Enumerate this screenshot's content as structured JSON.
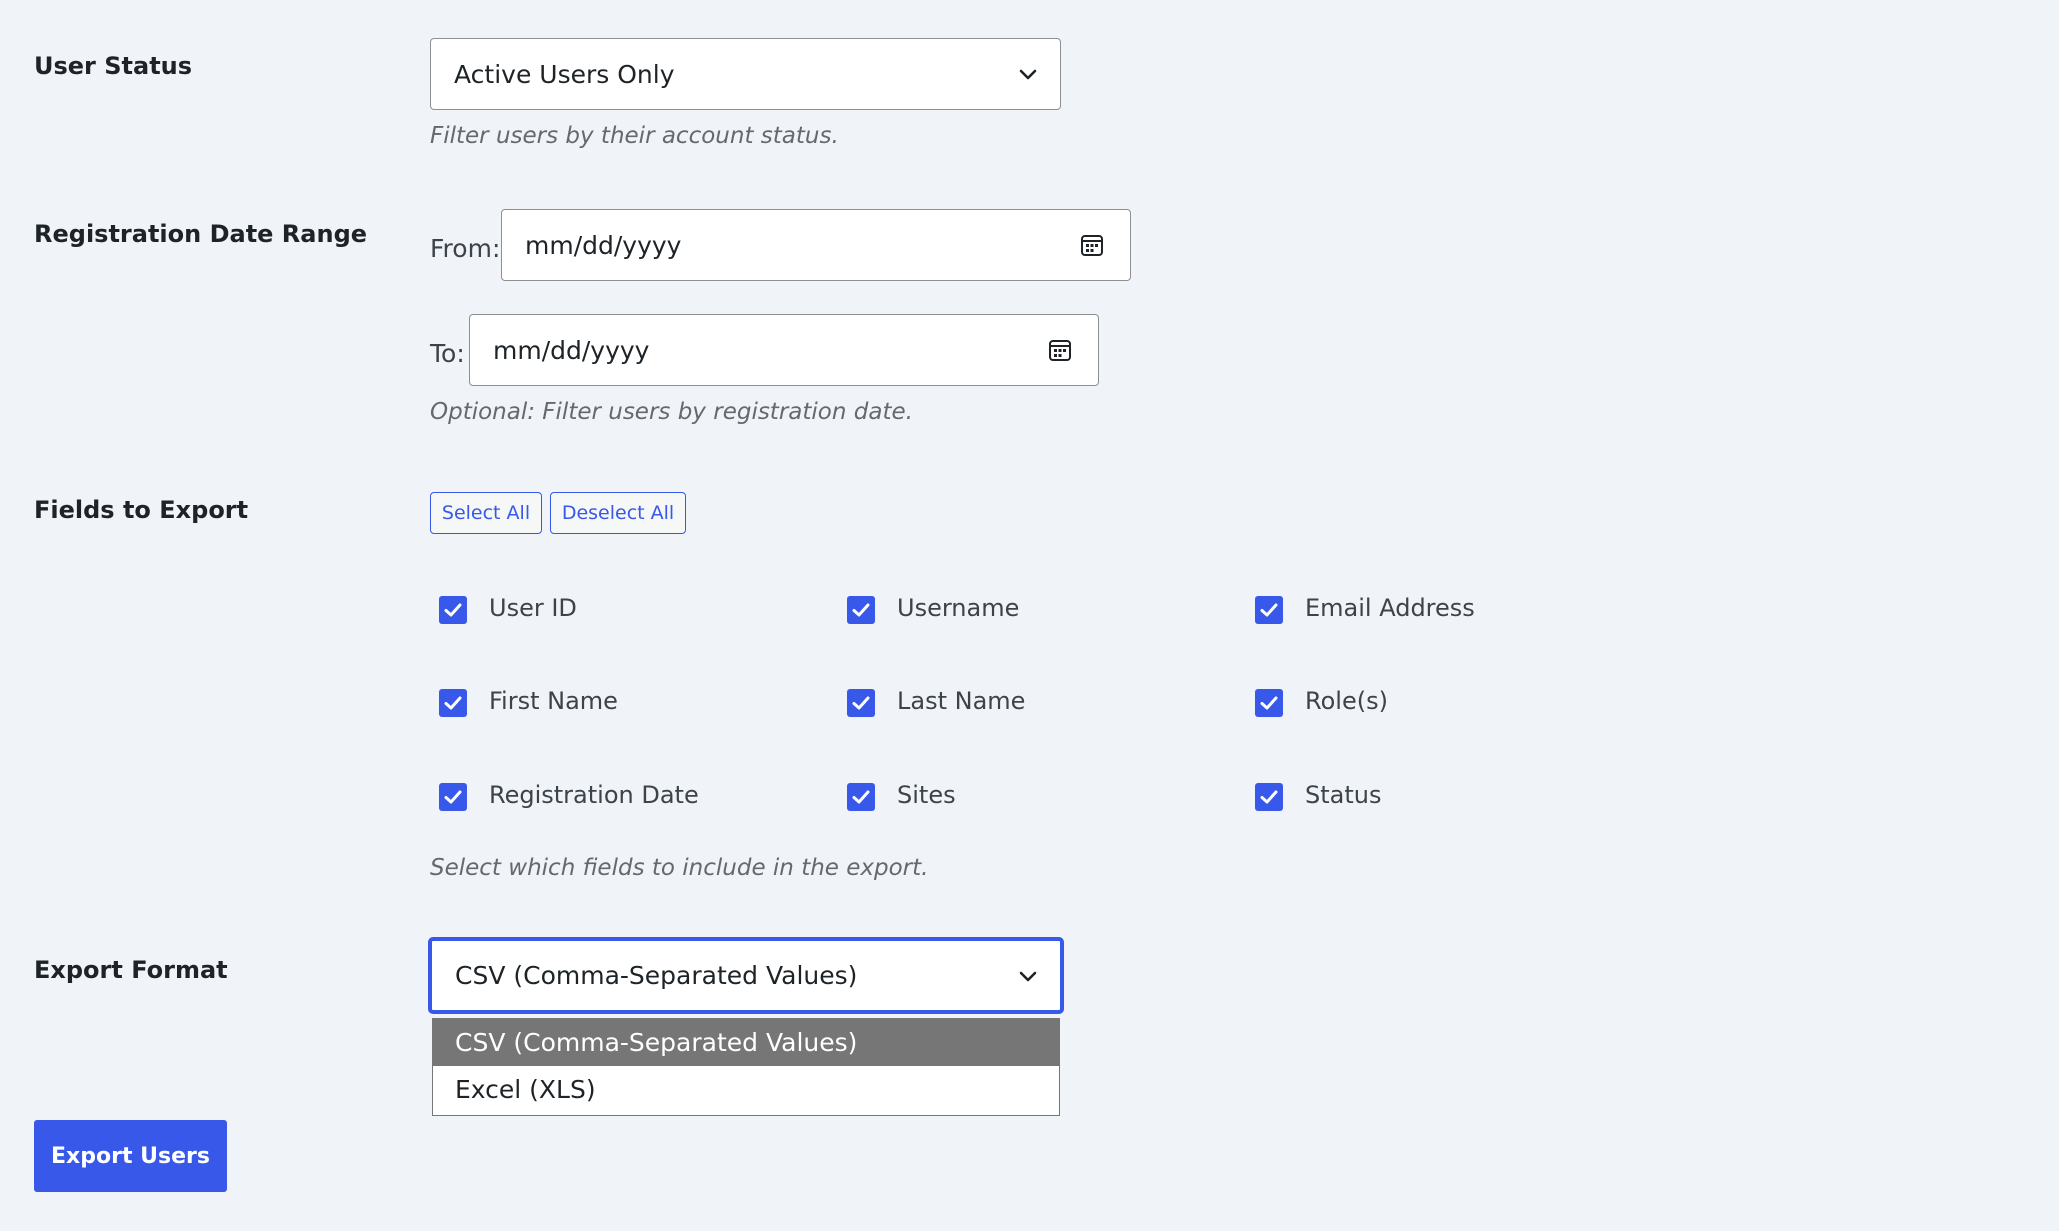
{
  "user_status": {
    "label": "User Status",
    "selected": "Active Users Only",
    "description": "Filter users by their account status."
  },
  "registration_date": {
    "label": "Registration Date Range",
    "from_label": "From:",
    "from_placeholder": "mm/dd/yyyy",
    "to_label": "To:",
    "to_placeholder": "mm/dd/yyyy",
    "description": "Optional: Filter users by registration date."
  },
  "fields": {
    "label": "Fields to Export",
    "select_all": "Select All",
    "deselect_all": "Deselect All",
    "items": [
      {
        "label": "User ID",
        "checked": true
      },
      {
        "label": "Username",
        "checked": true
      },
      {
        "label": "Email Address",
        "checked": true
      },
      {
        "label": "First Name",
        "checked": true
      },
      {
        "label": "Last Name",
        "checked": true
      },
      {
        "label": "Role(s)",
        "checked": true
      },
      {
        "label": "Registration Date",
        "checked": true
      },
      {
        "label": "Sites",
        "checked": true
      },
      {
        "label": "Status",
        "checked": true
      }
    ],
    "description": "Select which fields to include in the export."
  },
  "export_format": {
    "label": "Export Format",
    "selected": "CSV (Comma-Separated Values)",
    "options": [
      "CSV (Comma-Separated Values)",
      "Excel (XLS)"
    ],
    "highlighted_index": 0
  },
  "export_button": "Export Users",
  "colors": {
    "accent": "#3858e9",
    "background": "#f0f3f7",
    "highlight_option": "#767676"
  }
}
